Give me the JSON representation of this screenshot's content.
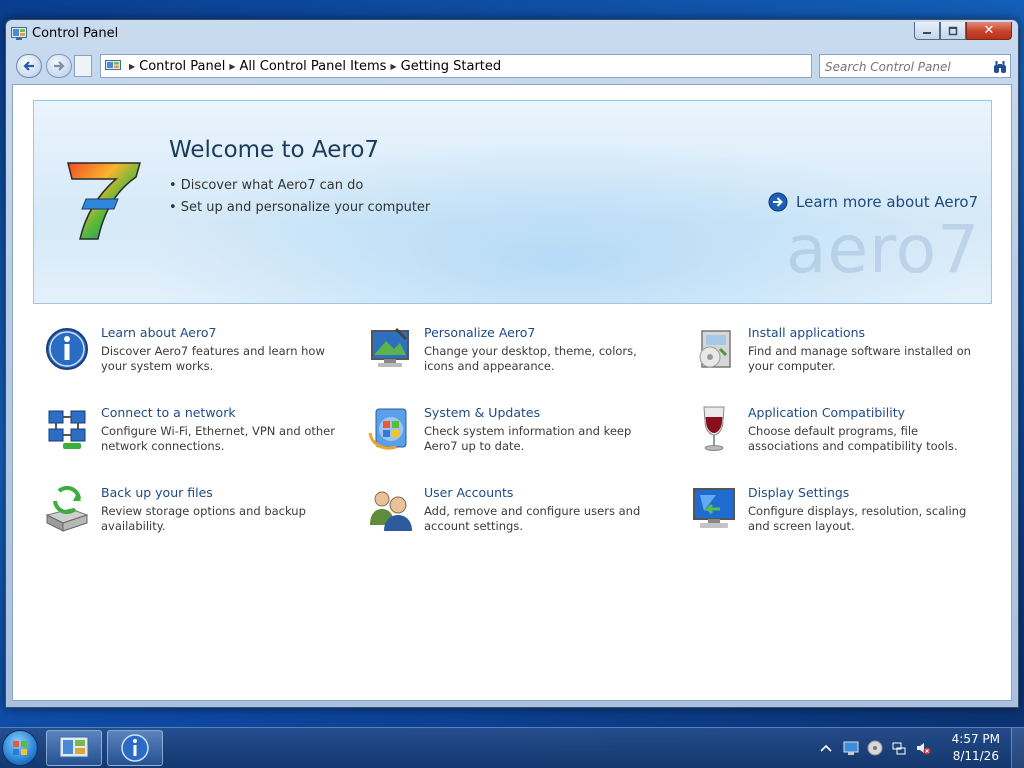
{
  "window": {
    "title": "Control Panel",
    "caption_buttons": {
      "close": "✕"
    }
  },
  "address": {
    "crumbs": [
      "Control Panel",
      "All Control Panel Items",
      "Getting Started"
    ]
  },
  "search": {
    "placeholder": "Search Control Panel"
  },
  "banner": {
    "title": "Welcome to Aero7",
    "bullets": [
      "• Discover what Aero7 can do",
      "• Set up and personalize your computer"
    ],
    "learn_more": "Learn more about Aero7",
    "watermark": "aero7"
  },
  "tasks": [
    {
      "title": "Learn about Aero7",
      "desc": "Discover Aero7 features and learn how your system works.",
      "icon": "info-icon"
    },
    {
      "title": "Personalize Aero7",
      "desc": "Change your desktop, theme, colors, icons and appearance.",
      "icon": "monitor-paint-icon"
    },
    {
      "title": "Install applications",
      "desc": "Find and manage software installed on your computer.",
      "icon": "install-box-icon"
    },
    {
      "title": "Connect to a network",
      "desc": "Configure Wi-Fi, Ethernet, VPN and other network connections.",
      "icon": "network-icon"
    },
    {
      "title": "System & Updates",
      "desc": "Check system information and keep Aero7 up to date.",
      "icon": "windows-update-icon"
    },
    {
      "title": "Application Compatibility",
      "desc": "Choose default programs, file associations and compatibility tools.",
      "icon": "wine-glass-icon"
    },
    {
      "title": "Back up your files",
      "desc": "Review storage options and backup availability.",
      "icon": "backup-drive-icon"
    },
    {
      "title": "User Accounts",
      "desc": "Add, remove and configure users and account settings.",
      "icon": "users-icon"
    },
    {
      "title": "Display Settings",
      "desc": "Configure displays, resolution, scaling and screen layout.",
      "icon": "display-icon"
    }
  ],
  "taskbar": {
    "time": "4:57 PM",
    "date": "8/11/26"
  },
  "colors": {
    "link": "#1e4a8a",
    "title": "#1b3a5c",
    "banner_bg": "#d5e9f8",
    "close_red": "#c7432b"
  }
}
